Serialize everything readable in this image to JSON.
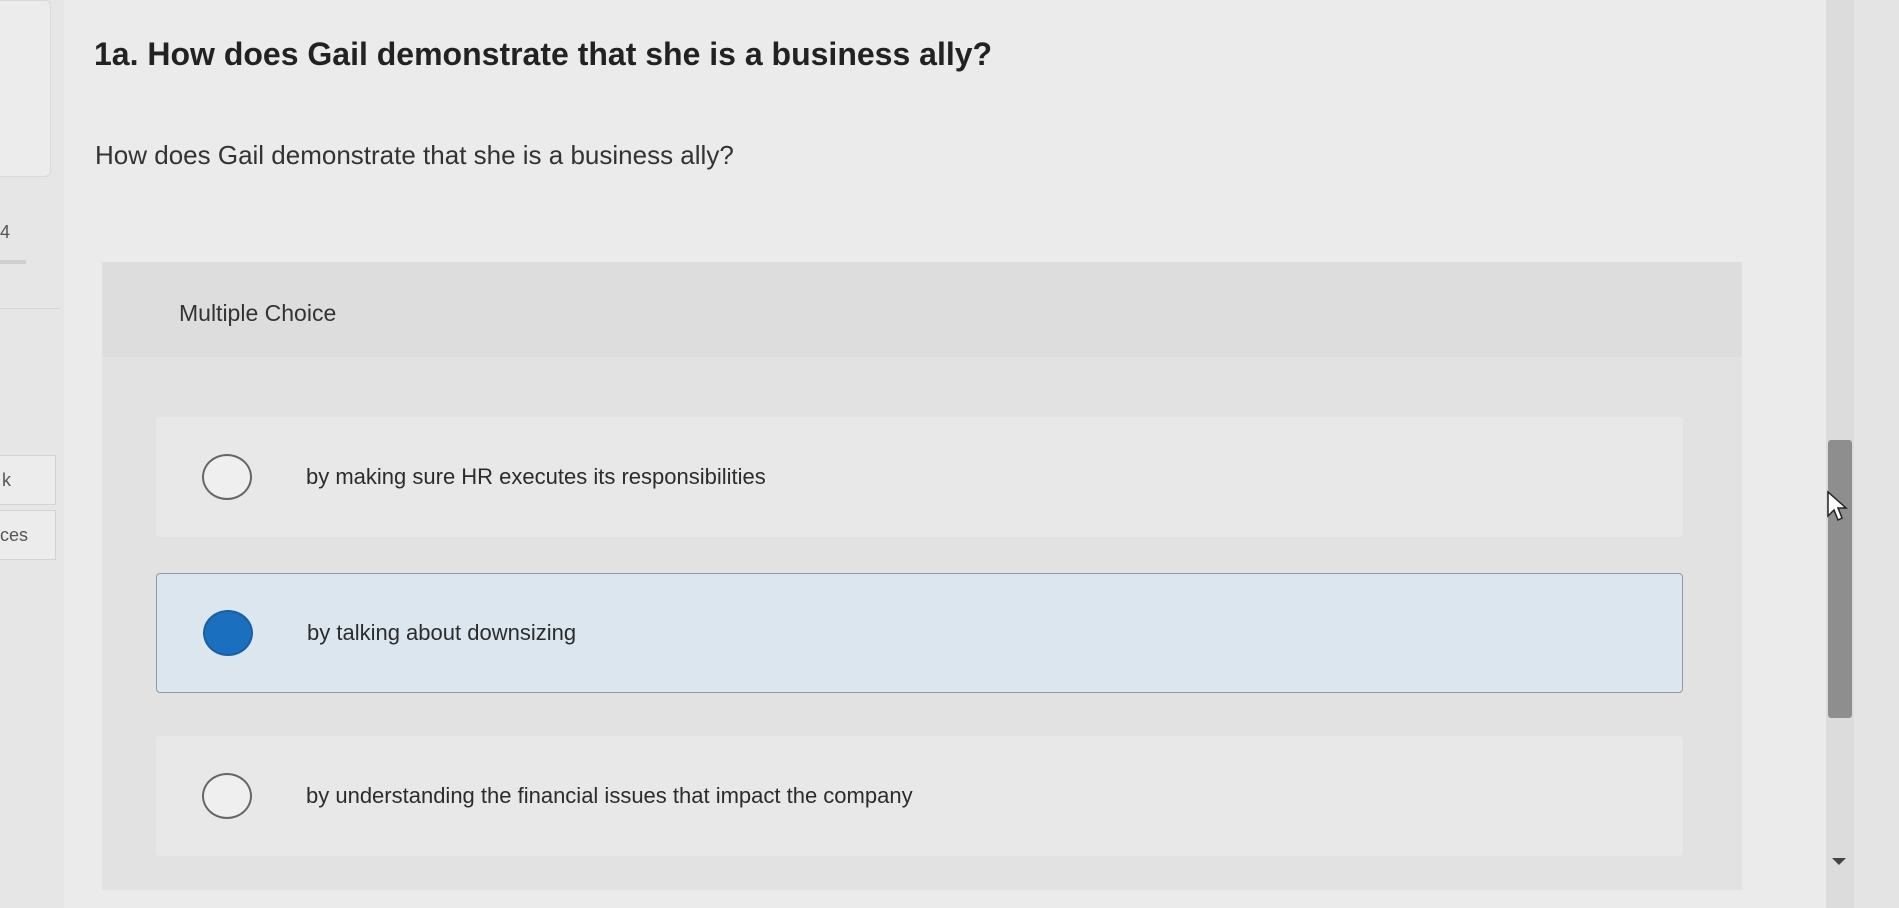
{
  "sidebar": {
    "number": "4",
    "button_1_label": "k",
    "button_2_label": "ces"
  },
  "question": {
    "title": "1a. How does Gail demonstrate that she is a business ally?",
    "prompt": "How does Gail demonstrate that she is a business ally?"
  },
  "multiple_choice": {
    "label": "Multiple Choice",
    "options": [
      {
        "text": "by making sure HR executes its responsibilities",
        "selected": false
      },
      {
        "text": "by talking about downsizing",
        "selected": true
      },
      {
        "text": "by understanding the financial issues that impact the company",
        "selected": false
      }
    ]
  },
  "colors": {
    "selected_radio": "#1a6fbe",
    "selected_background": "#dbe6ef"
  }
}
